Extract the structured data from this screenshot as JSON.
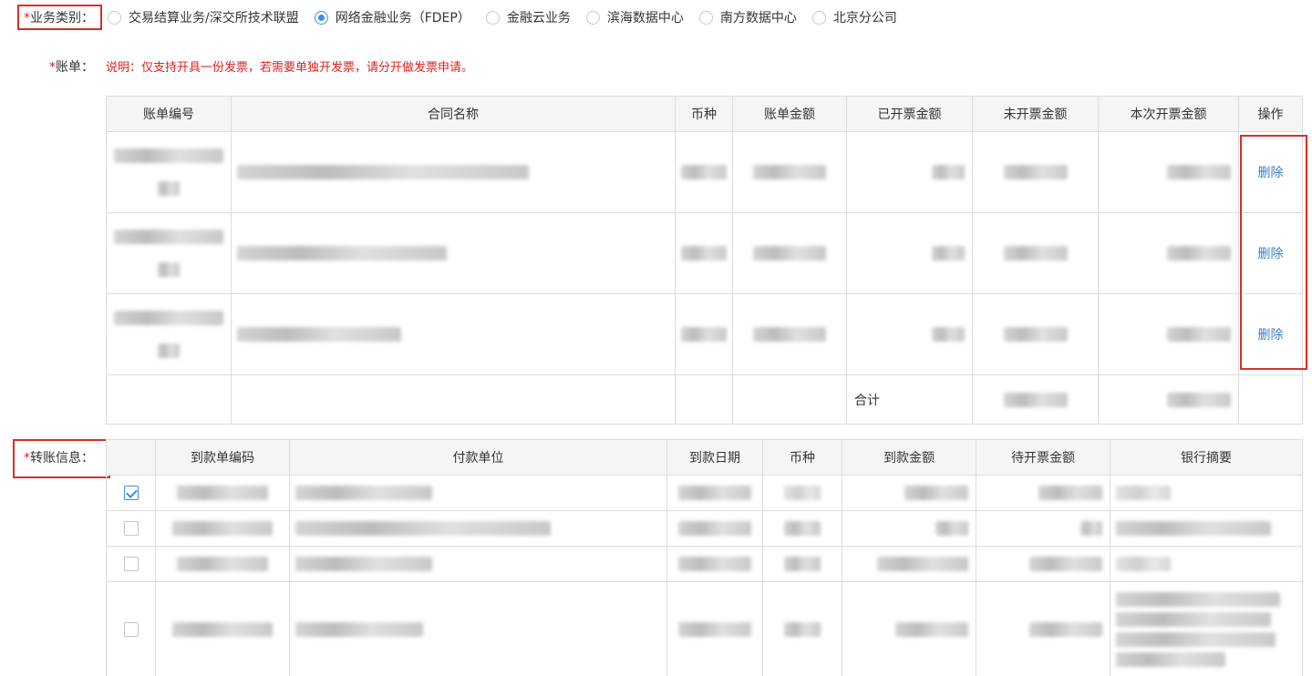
{
  "business_type": {
    "required_mark": "*",
    "label": "业务类别：",
    "options": [
      {
        "label": "交易结算业务/深交所技术联盟",
        "checked": false
      },
      {
        "label": "网络金融业务（FDEP）",
        "checked": true
      },
      {
        "label": "金融云业务",
        "checked": false
      },
      {
        "label": "滨海数据中心",
        "checked": false
      },
      {
        "label": "南方数据中心",
        "checked": false
      },
      {
        "label": "北京分公司",
        "checked": false
      }
    ]
  },
  "bill": {
    "required_mark": "*",
    "label": "账单：",
    "note": "说明：仅支持开具一份发票，若需要单独开发票，请分开做发票申请。",
    "columns": [
      "账单编号",
      "合同名称",
      "币种",
      "账单金额",
      "已开票金额",
      "未开票金额",
      "本次开票金额",
      "操作"
    ],
    "row_action": "删除",
    "sum_label": "合计"
  },
  "transfer": {
    "required_mark": "*",
    "label": "转账信息：",
    "columns": [
      "",
      "到款单编码",
      "付款单位",
      "到款日期",
      "币种",
      "到款金额",
      "待开票金额",
      "银行摘要"
    ],
    "rows_checked": [
      true,
      false,
      false,
      false
    ]
  },
  "colors": {
    "accent": "#3a8ee6",
    "required": "#e02020",
    "highlight_box": "#d9302b",
    "link": "#3a7fc8"
  }
}
